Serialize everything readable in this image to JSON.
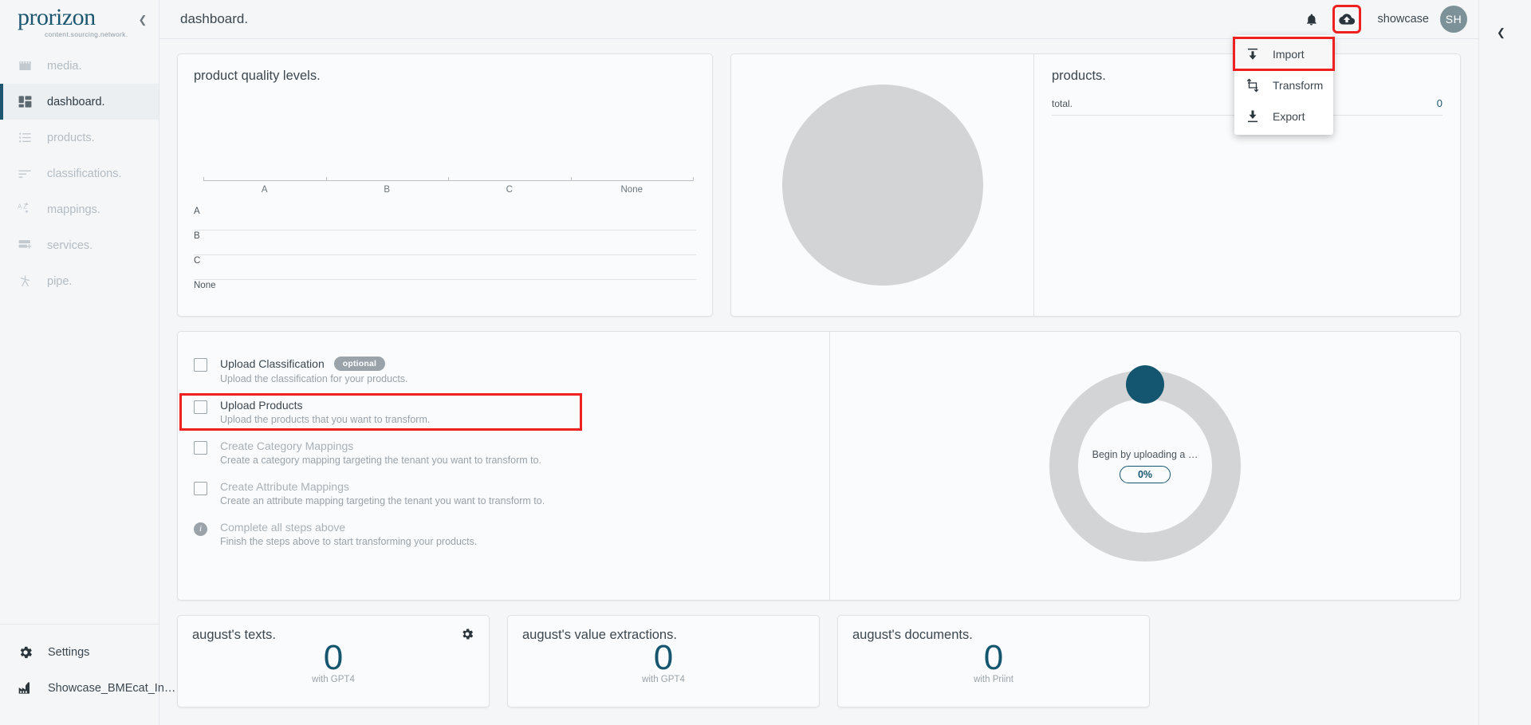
{
  "brand": {
    "name": "prorizon",
    "tagline": "content.sourcing.network."
  },
  "sidebar": {
    "collapse_icon": "chevron-left-icon",
    "items": [
      {
        "label": "media.",
        "icon": "film-icon",
        "active": false
      },
      {
        "label": "dashboard.",
        "icon": "dashboard-grid-icon",
        "active": true
      },
      {
        "label": "products.",
        "icon": "list-icon",
        "active": false
      },
      {
        "label": "classifications.",
        "icon": "sort-lines-icon",
        "active": false
      },
      {
        "label": "mappings.",
        "icon": "az-sort-icon",
        "active": false
      },
      {
        "label": "services.",
        "icon": "server-add-icon",
        "active": false
      },
      {
        "label": "pipe.",
        "icon": "pipe-person-icon",
        "active": false
      }
    ],
    "bottom": [
      {
        "label": "Settings",
        "icon": "gear-icon"
      },
      {
        "label": "Showcase_BMEcat_In…",
        "icon": "factory-icon"
      }
    ]
  },
  "topbar": {
    "title": "dashboard.",
    "notification_icon": "bell-icon",
    "upload_icon": "cloud-upload-icon",
    "user_name": "showcase",
    "avatar_initials": "SH"
  },
  "dropdown": {
    "items": [
      {
        "label": "Import",
        "icon": "import-arrow-up-icon",
        "highlighted": true
      },
      {
        "label": "Transform",
        "icon": "transform-crop-icon",
        "highlighted": false
      },
      {
        "label": "Export",
        "icon": "export-arrow-down-icon",
        "highlighted": false
      }
    ]
  },
  "quality_card": {
    "title": "product quality levels."
  },
  "products_card": {
    "title": "products.",
    "total_label": "total.",
    "total_value": "0"
  },
  "checklist": {
    "items": [
      {
        "title": "Upload Classification",
        "badge": "optional",
        "desc": "Upload the classification for your products.",
        "muted": false,
        "highlighted": false,
        "control": "checkbox"
      },
      {
        "title": "Upload Products",
        "badge": "",
        "desc": "Upload the products that you want to transform.",
        "muted": false,
        "highlighted": true,
        "control": "checkbox"
      },
      {
        "title": "Create Category Mappings",
        "badge": "",
        "desc": "Create a category mapping targeting the tenant you want to transform to.",
        "muted": true,
        "highlighted": false,
        "control": "checkbox"
      },
      {
        "title": "Create Attribute Mappings",
        "badge": "",
        "desc": "Create an attribute mapping targeting the tenant you want to transform to.",
        "muted": true,
        "highlighted": false,
        "control": "checkbox"
      },
      {
        "title": "Complete all steps above",
        "badge": "",
        "desc": "Finish the steps above to start transforming your products.",
        "muted": true,
        "highlighted": false,
        "control": "info"
      }
    ]
  },
  "progress": {
    "label": "Begin by uploading a …",
    "percent_label": "0%",
    "percent_value": 0,
    "accent_color": "#14566f",
    "track_color": "#d3d4d6"
  },
  "stats": [
    {
      "title": "august's texts.",
      "value": "0",
      "sub": "with GPT4",
      "gear": true
    },
    {
      "title": "august's value extractions.",
      "value": "0",
      "sub": "with GPT4",
      "gear": false
    },
    {
      "title": "august's documents.",
      "value": "0",
      "sub": "with Priint",
      "gear": false
    }
  ],
  "right_rail": {
    "collapse_icon": "chevron-left-icon"
  },
  "chart_data": {
    "type": "bar",
    "title": "product quality levels.",
    "categories": [
      "A",
      "B",
      "C",
      "None"
    ],
    "values": [
      0,
      0,
      0,
      0
    ],
    "y_categories": [
      "A",
      "B",
      "C",
      "None"
    ],
    "xlabel": "",
    "ylabel": "",
    "grid": true,
    "legend": "none",
    "note": "empty chart - no bars rendered"
  }
}
